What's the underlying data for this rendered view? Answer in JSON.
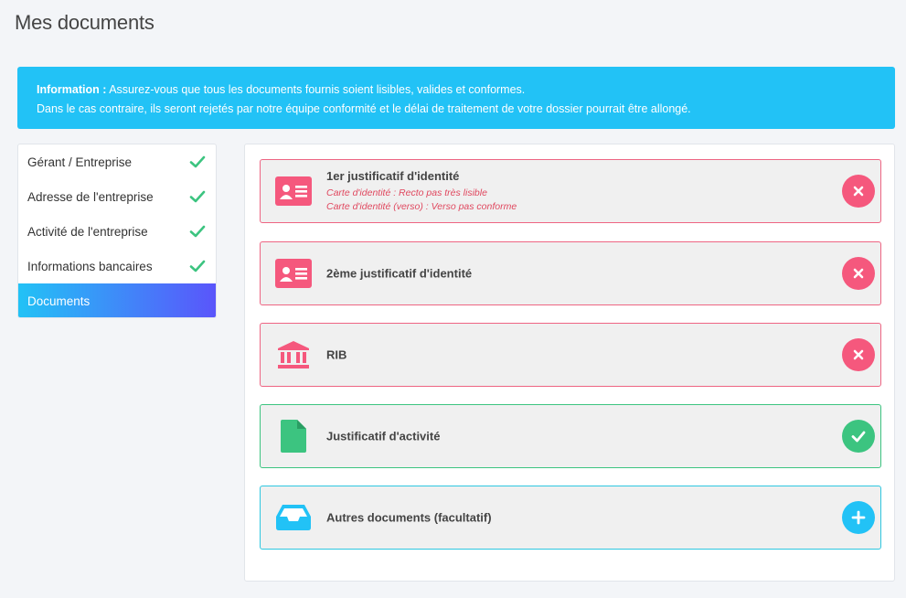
{
  "page": {
    "title": "Mes documents"
  },
  "banner": {
    "label": "Information :",
    "line1": "Assurez-vous que tous les documents fournis soient lisibles, valides et conformes.",
    "line2": "Dans le cas contraire, ils seront rejetés par notre équipe conformité et le délai de traitement de votre dossier pourrait être allongé."
  },
  "sidebar": {
    "items": [
      {
        "label": "Gérant / Entreprise",
        "completed": true
      },
      {
        "label": "Adresse de l'entreprise",
        "completed": true
      },
      {
        "label": "Activité de l'entreprise",
        "completed": true
      },
      {
        "label": "Informations bancaires",
        "completed": true
      },
      {
        "label": "Documents",
        "active": true
      }
    ]
  },
  "documents": [
    {
      "title": "1er justificatif d'identité",
      "notes": [
        "Carte d'identité : Recto pas très lisible",
        "Carte d'identité (verso) : Verso pas conforme"
      ],
      "icon": "id-card-icon",
      "status": "rejected"
    },
    {
      "title": "2ème justificatif d'identité",
      "icon": "id-card-icon",
      "status": "rejected"
    },
    {
      "title": "RIB",
      "icon": "bank-icon",
      "status": "rejected"
    },
    {
      "title": "Justificatif d'activité",
      "icon": "file-icon",
      "status": "validated"
    },
    {
      "title": "Autres documents (facultatif)",
      "icon": "inbox-icon",
      "status": "add"
    }
  ],
  "colors": {
    "accent": "#22c2f6",
    "rejected": "#f5587d",
    "validated": "#3cc480",
    "sidebar_gradient_end": "#5a55fb"
  }
}
